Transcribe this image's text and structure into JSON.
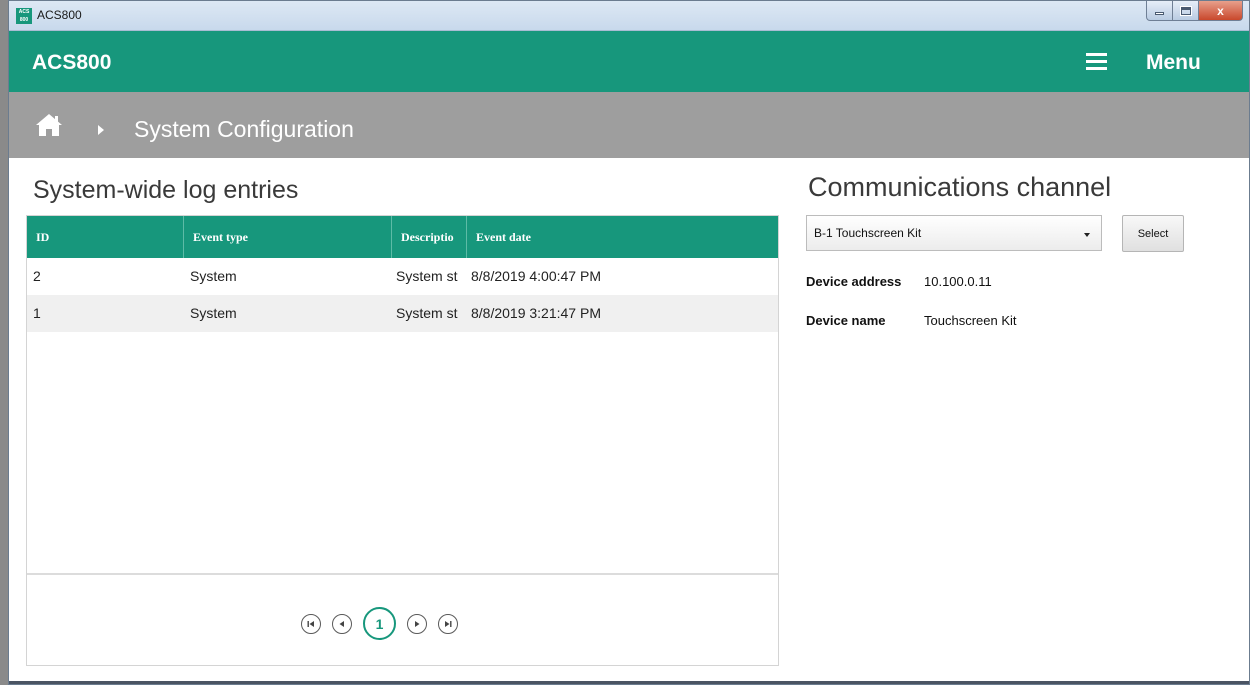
{
  "window": {
    "title": "ACS800",
    "icon_text": "ACS 800",
    "min_icon": "minimize-icon",
    "max_icon": "maximize-icon",
    "close_glyph": "x"
  },
  "header": {
    "app_name": "ACS800",
    "menu_label": "Menu",
    "menu_icon": "hamburger-icon"
  },
  "breadcrumb": {
    "home_icon": "home-icon",
    "separator_icon": "chevron-right-icon",
    "current": "System Configuration"
  },
  "log": {
    "title": "System-wide log entries",
    "columns": [
      "ID",
      "Event type",
      "Descriptio",
      "Event date"
    ],
    "rows": [
      {
        "id": "2",
        "type": "System",
        "description": "System st",
        "date": "8/8/2019 4:00:47 PM"
      },
      {
        "id": "1",
        "type": "System",
        "description": "System st",
        "date": "8/8/2019 3:21:47 PM"
      }
    ],
    "pager": {
      "first": "first-page-icon",
      "prev": "previous-page-icon",
      "current_page": "1",
      "next": "next-page-icon",
      "last": "last-page-icon"
    }
  },
  "comm": {
    "title": "Communications channel",
    "selected_channel": "B-1 Touchscreen Kit",
    "select_label": "Select",
    "device_address_label": "Device address",
    "device_address": "10.100.0.11",
    "device_name_label": "Device name",
    "device_name": "Touchscreen Kit"
  },
  "colors": {
    "accent": "#17977c",
    "breadcrumb_bg": "#9e9e9e"
  }
}
